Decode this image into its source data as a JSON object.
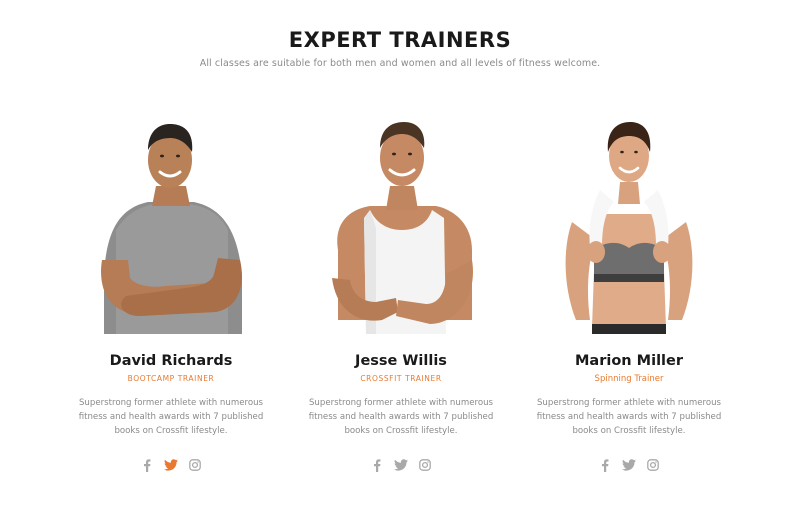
{
  "section": {
    "title": "EXPERT TRAINERS",
    "subtitle": "All classes are suitable for both men and women and all levels of fitness welcome."
  },
  "colors": {
    "accent": "#e87a2f",
    "muted_icon": "#a9a9a9",
    "heading": "#1a1a1a",
    "body_text": "#8a8a8a"
  },
  "trainers": [
    {
      "name": "David Richards",
      "role": "BOOTCAMP TRAINER",
      "bio": "Superstrong former athlete with numerous fitness and health awards with 7 published books on Crossfit lifestyle.",
      "photo_icon": "trainer-photo-david",
      "socials": [
        {
          "icon": "facebook-icon",
          "active": false
        },
        {
          "icon": "twitter-icon",
          "active": true
        },
        {
          "icon": "instagram-icon",
          "active": false
        }
      ]
    },
    {
      "name": "Jesse Willis",
      "role": "CROSSFIT TRAINER",
      "bio": "Superstrong former athlete with numerous fitness and health awards with 7 published books on Crossfit lifestyle.",
      "photo_icon": "trainer-photo-jesse",
      "socials": [
        {
          "icon": "facebook-icon",
          "active": false
        },
        {
          "icon": "twitter-icon",
          "active": false
        },
        {
          "icon": "instagram-icon",
          "active": false
        }
      ]
    },
    {
      "name": "Marion Miller",
      "role": "Spinning Trainer",
      "bio": "Superstrong former athlete with numerous fitness and health awards with 7 published books on Crossfit lifestyle.",
      "photo_icon": "trainer-photo-marion",
      "socials": [
        {
          "icon": "facebook-icon",
          "active": false
        },
        {
          "icon": "twitter-icon",
          "active": false
        },
        {
          "icon": "instagram-icon",
          "active": false
        }
      ]
    }
  ]
}
